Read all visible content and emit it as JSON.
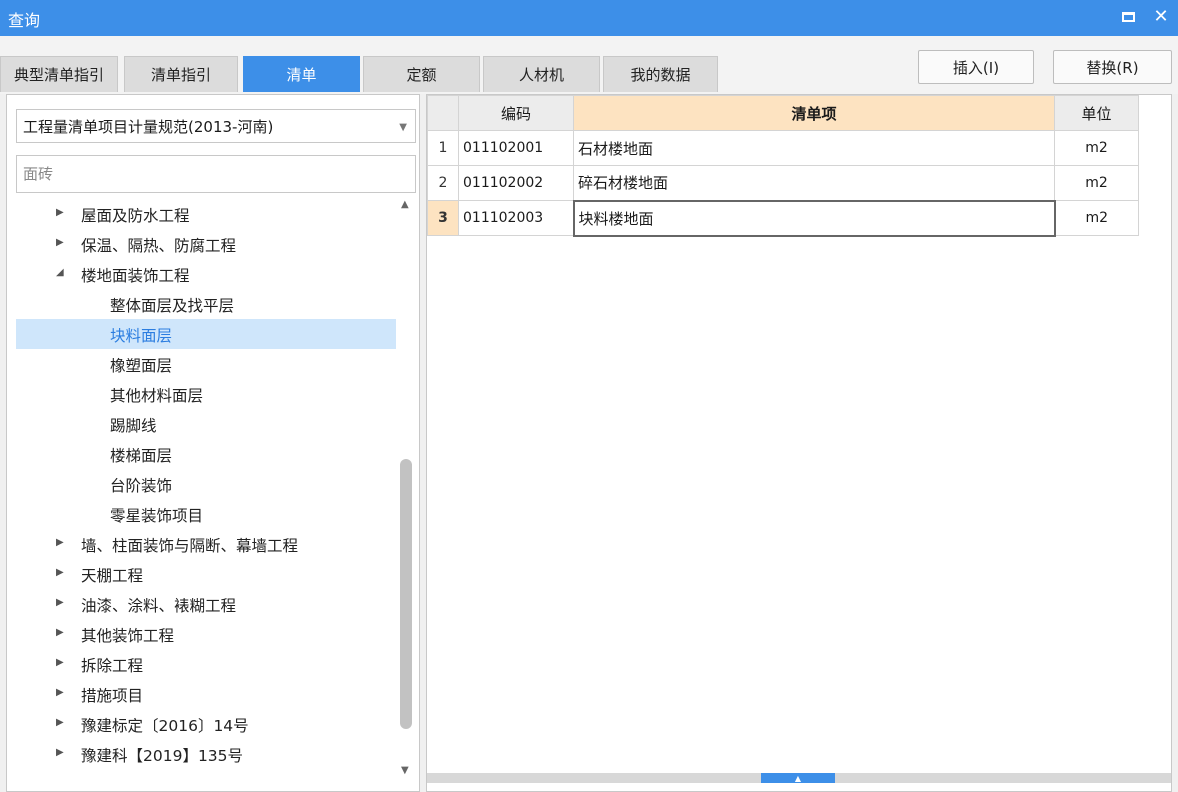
{
  "window": {
    "title": "查询",
    "maximize_icon": "maximize-icon",
    "close_glyph": "✕"
  },
  "tabs": [
    {
      "label": "典型清单指引",
      "active": false
    },
    {
      "label": "清单指引",
      "active": false
    },
    {
      "label": "清单",
      "active": true
    },
    {
      "label": "定额",
      "active": false
    },
    {
      "label": "人材机",
      "active": false
    },
    {
      "label": "我的数据",
      "active": false
    }
  ],
  "toolbar": {
    "insert_label": "插入(I)",
    "replace_label": "替换(R)"
  },
  "left": {
    "spec_select": "工程量清单项目计量规范(2013-河南)",
    "search_placeholder": "面砖",
    "tree": [
      {
        "label": "屋面及防水工程",
        "level": 1,
        "state": "collapsed"
      },
      {
        "label": "保温、隔热、防腐工程",
        "level": 1,
        "state": "collapsed"
      },
      {
        "label": "楼地面装饰工程",
        "level": 1,
        "state": "expanded"
      },
      {
        "label": "整体面层及找平层",
        "level": 2
      },
      {
        "label": "块料面层",
        "level": 2,
        "selected": true
      },
      {
        "label": "橡塑面层",
        "level": 2
      },
      {
        "label": "其他材料面层",
        "level": 2
      },
      {
        "label": "踢脚线",
        "level": 2
      },
      {
        "label": "楼梯面层",
        "level": 2
      },
      {
        "label": "台阶装饰",
        "level": 2
      },
      {
        "label": "零星装饰项目",
        "level": 2
      },
      {
        "label": "墙、柱面装饰与隔断、幕墙工程",
        "level": 1,
        "state": "collapsed"
      },
      {
        "label": "天棚工程",
        "level": 1,
        "state": "collapsed"
      },
      {
        "label": "油漆、涂料、裱糊工程",
        "level": 1,
        "state": "collapsed"
      },
      {
        "label": "其他装饰工程",
        "level": 1,
        "state": "collapsed"
      },
      {
        "label": "拆除工程",
        "level": 1,
        "state": "collapsed"
      },
      {
        "label": "措施项目",
        "level": 1,
        "state": "collapsed"
      },
      {
        "label": "豫建标定〔2016〕14号",
        "level": 1,
        "state": "collapsed"
      },
      {
        "label": "豫建科【2019】135号",
        "level": 1,
        "state": "collapsed"
      }
    ]
  },
  "grid": {
    "columns": {
      "code": "编码",
      "item": "清单项",
      "unit": "单位"
    },
    "rows": [
      {
        "no": "1",
        "code": "011102001",
        "item": "石材楼地面",
        "unit": "m2"
      },
      {
        "no": "2",
        "code": "011102002",
        "item": "碎石材楼地面",
        "unit": "m2"
      },
      {
        "no": "3",
        "code": "011102003",
        "item": "块料楼地面",
        "unit": "m2",
        "current": true
      }
    ]
  },
  "colors": {
    "accent": "#3d8fe8",
    "selected_row": "#cfe6fb",
    "highlight_header": "#fde3c1"
  }
}
